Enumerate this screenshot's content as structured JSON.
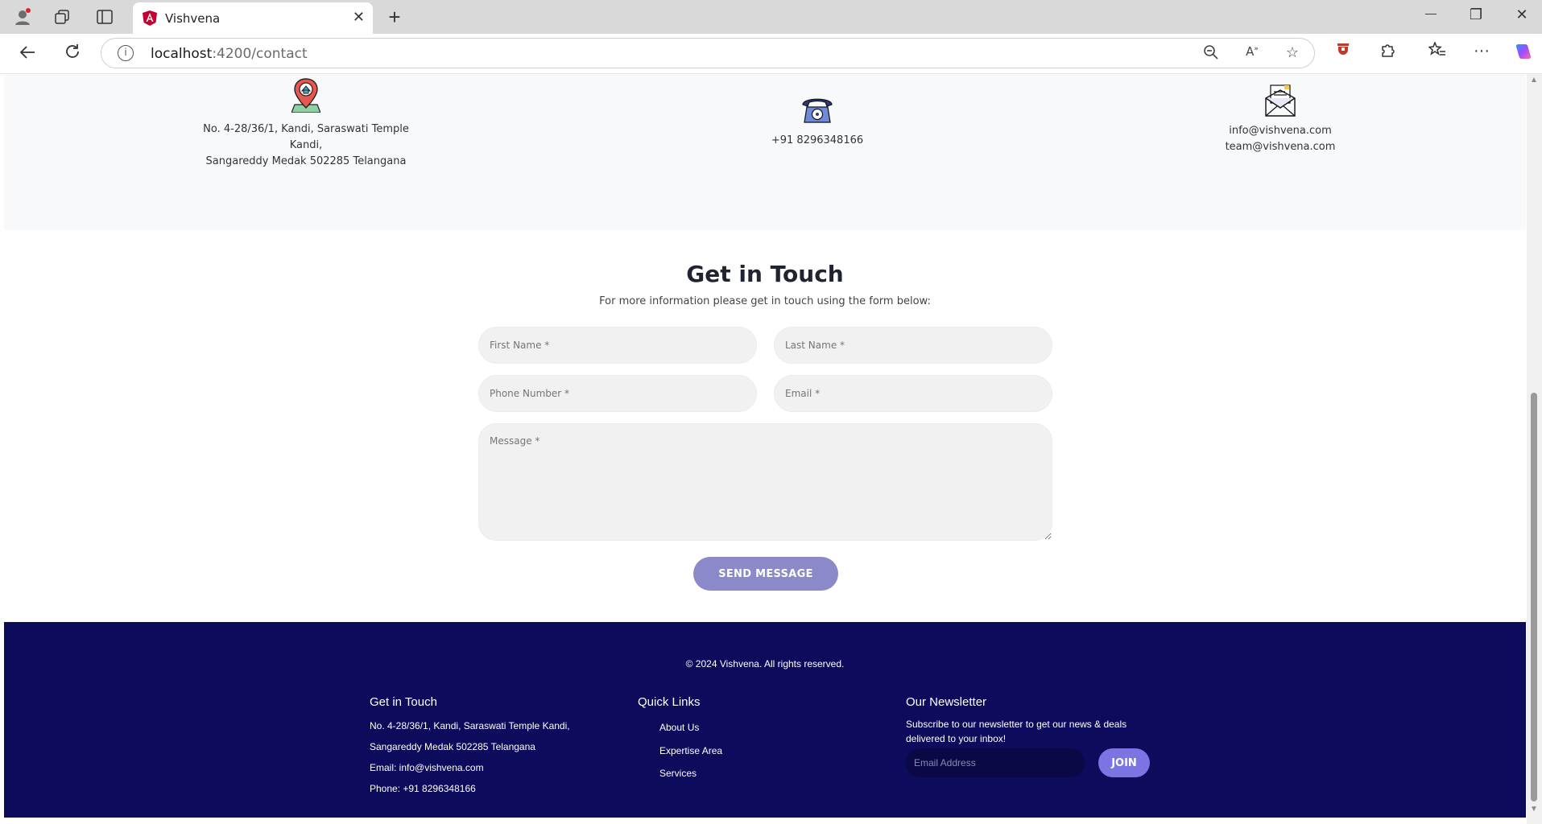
{
  "browser": {
    "tab_title": "Vishvena",
    "tab_close": "✕",
    "new_tab": "+",
    "url_host": "localhost",
    "url_path": ":4200/contact",
    "win_minimize": "—",
    "win_restore": "❐",
    "win_close": "✕"
  },
  "contact_info": {
    "address_line1": "No. 4-28/36/1, Kandi, Saraswati Temple",
    "address_line2": "Kandi,",
    "address_line3": "Sangareddy Medak 502285 Telangana",
    "phone": "+91 8296348166",
    "email1": "info@vishvena.com",
    "email2": "team@vishvena.com"
  },
  "form": {
    "title": "Get in Touch",
    "subtitle": "For more information please get in touch using the form below:",
    "first_name_placeholder": "First Name *",
    "last_name_placeholder": "Last Name *",
    "phone_placeholder": "Phone Number *",
    "email_placeholder": "Email *",
    "message_placeholder": "Message *",
    "send_label": "SEND MESSAGE"
  },
  "footer": {
    "copyright": "© 2024 Vishvena. All rights reserved.",
    "get_in_touch": {
      "heading": "Get in Touch",
      "line1": "No. 4-28/36/1, Kandi, Saraswati Temple Kandi,",
      "line2": "Sangareddy Medak 502285 Telangana",
      "email": "Email: info@vishvena.com",
      "phone": "Phone: +91 8296348166"
    },
    "quick_links": {
      "heading": "Quick Links",
      "items": [
        "About Us",
        "Expertise Area",
        "Services"
      ]
    },
    "newsletter": {
      "heading": "Our Newsletter",
      "text_line1": "Subscribe to our newsletter to get our news & deals",
      "text_line2": "delivered to your inbox!",
      "email_placeholder": "Email Address",
      "join_label": "JOIN"
    }
  },
  "colors": {
    "accent_button": "#8b89c9",
    "footer_bg": "#0d0b5c",
    "join_button": "#7b75e3"
  }
}
